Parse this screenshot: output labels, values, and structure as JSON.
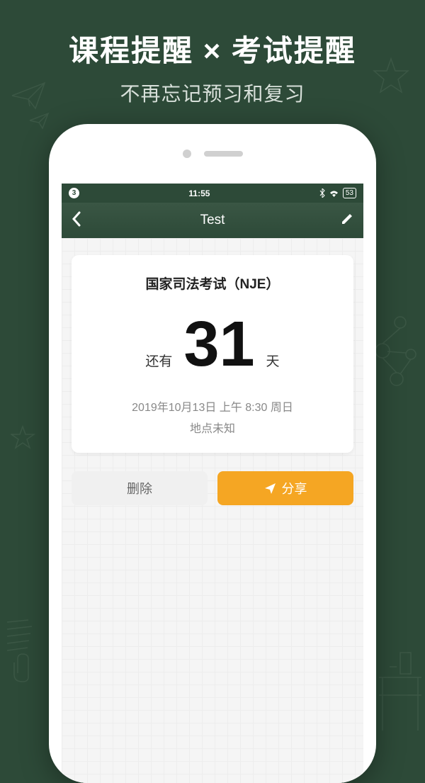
{
  "promo": {
    "title": "课程提醒 × 考试提醒",
    "subtitle": "不再忘记预习和复习"
  },
  "statusbar": {
    "notif_count": "3",
    "time": "11:55",
    "battery": "53"
  },
  "navbar": {
    "title": "Test"
  },
  "card": {
    "title": "国家司法考试（NJE）",
    "prefix": "还有",
    "number": "31",
    "suffix": "天",
    "datetime": "2019年10月13日 上午 8:30 周日",
    "location": "地点未知"
  },
  "buttons": {
    "delete": "删除",
    "share": "分享"
  }
}
